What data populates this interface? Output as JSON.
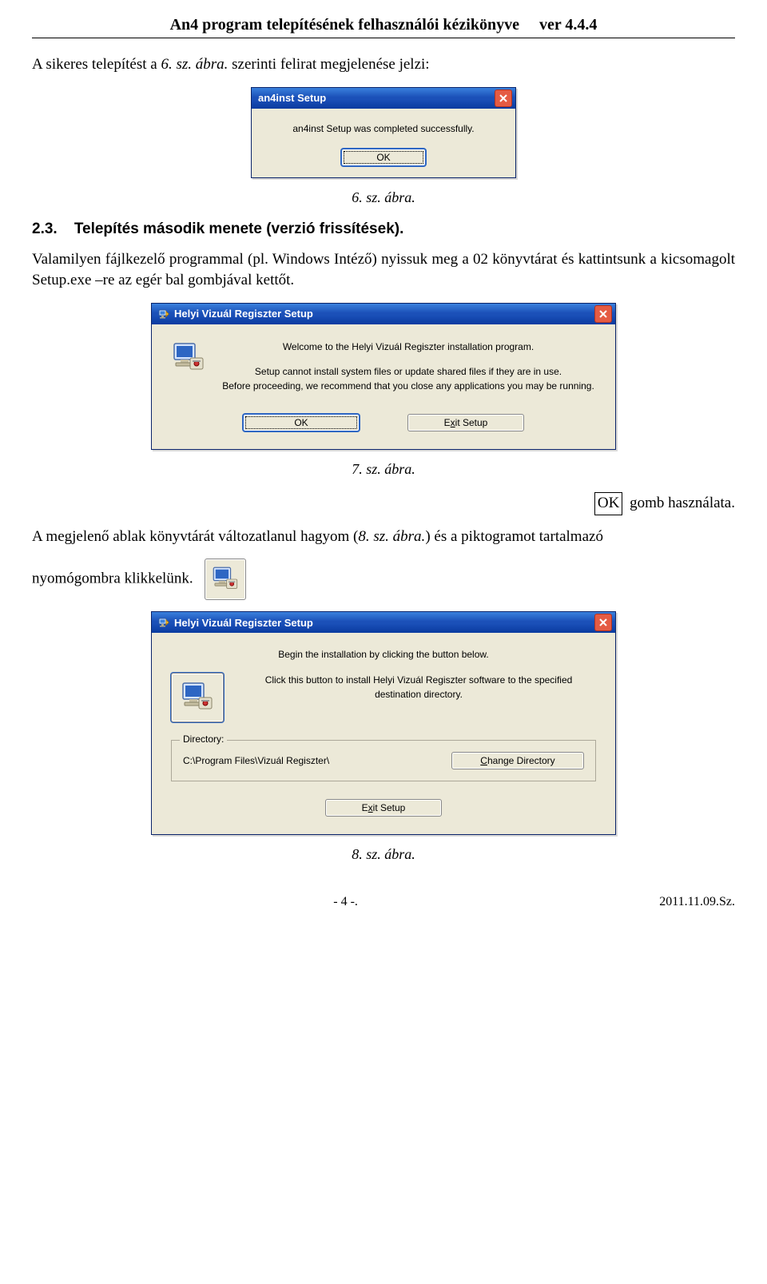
{
  "header": {
    "title_left": "An4 program telepítésének felhasználói kézikönyve",
    "title_right": "ver 4.4.4"
  },
  "intro_line_prefix": "A sikeres telepítést a ",
  "intro_line_italic": "6. sz. ábra.",
  "intro_line_suffix": " szerinti felirat megjelenése jelzi:",
  "msgbox": {
    "title": "an4inst Setup",
    "body": "an4inst Setup was completed successfully.",
    "ok": "OK"
  },
  "caption6": "6. sz. ábra.",
  "section23_number": "2.3.",
  "section23_title": "Telepítés második menete (verzió frissítések).",
  "para2": "Valamilyen fájlkezelő programmal (pl. Windows Intéző) nyissuk meg a 02 könyvtárat és kattintsunk a kicsomagolt Setup.exe –re az egér bal gombjával kettőt.",
  "dlg1": {
    "title": "Helyi Vizuál Regiszter Setup",
    "welcome": "Welcome to the Helyi Vizuál Regiszter installation program.",
    "warn1": "Setup cannot install system files or update shared files if they are in use.",
    "warn2": "Before proceeding, we recommend that you close any applications you may be running.",
    "ok": "OK",
    "exit_pre": "E",
    "exit_u": "x",
    "exit_post": "it Setup"
  },
  "caption7": "7. sz. ábra.",
  "after7_box": "OK",
  "after7_text": " gomb használata.",
  "para3_prefix": "A megjelenő ablak könyvtárát változatlanul hagyom (",
  "para3_italic": "8. sz. ábra.",
  "para3_suffix": ") és a piktogramot tartalmazó",
  "para4": "nyomógombra klikkelünk.",
  "dlg2": {
    "title": "Helyi Vizuál Regiszter Setup",
    "begin": "Begin the installation by clicking the button below.",
    "desc": "Click this button to install Helyi Vizuál Regiszter software to the specified destination directory.",
    "group": "Directory:",
    "path": "C:\\Program Files\\Vizuál Regiszter\\",
    "change_pre": "",
    "change_u": "C",
    "change_post": "hange Directory",
    "exit_pre": "E",
    "exit_u": "x",
    "exit_post": "it Setup"
  },
  "caption8": "8. sz. ábra.",
  "footer": {
    "page": "- 4 -.",
    "date": "2011.11.09.Sz."
  }
}
